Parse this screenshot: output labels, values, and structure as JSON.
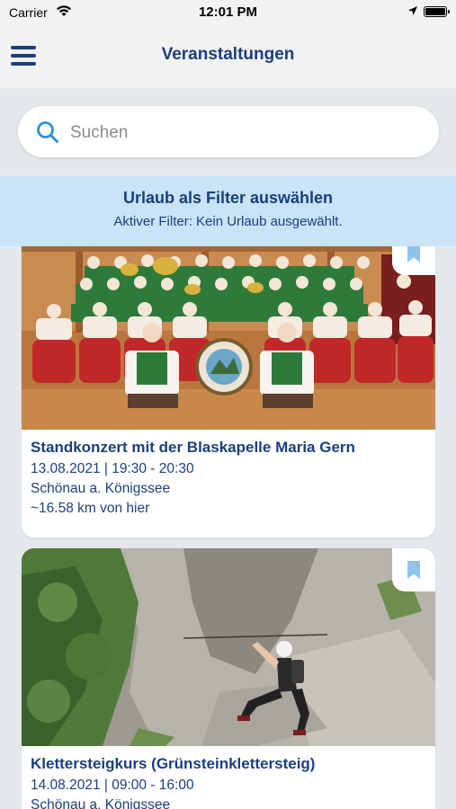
{
  "status_bar": {
    "carrier": "Carrier",
    "time": "12:01 PM"
  },
  "header": {
    "title": "Veranstaltungen"
  },
  "search": {
    "placeholder": "Suchen"
  },
  "filter": {
    "title": "Urlaub als Filter auswählen",
    "subtitle": "Aktiver Filter: Kein Urlaub ausgewählt."
  },
  "events": [
    {
      "title": "Standkonzert mit der Blaskapelle Maria Gern",
      "datetime": "13.08.2021 | 19:30 - 20:30",
      "location": "Schönau a. Königssee",
      "distance": "~16.58 km von hier",
      "image": "brass-band-group-photo"
    },
    {
      "title": "Klettersteigkurs (Grünsteinklettersteig)",
      "datetime": "14.08.2021 | 09:00 - 16:00",
      "location": "Schönau a. Königssee",
      "image": "via-ferrata-climber-photo"
    }
  ],
  "colors": {
    "brand": "#1b3f7a",
    "accent": "#2f8fd8",
    "filter_bg": "#c9e3f7",
    "page_bg": "#e4e8ec"
  }
}
